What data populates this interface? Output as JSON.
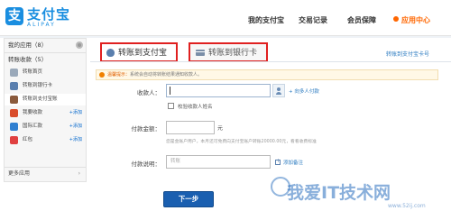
{
  "header": {
    "logo_cn": "支付宝",
    "logo_en": "ALIPAY",
    "nav": [
      "我的支付宝",
      "交易记录",
      "会员保障",
      "应用中心"
    ],
    "accent_nav_color": "#ff6600"
  },
  "sidebar": {
    "apps_title": "我的应用（8）",
    "collect_title": "转账收款（5）",
    "items": [
      {
        "label": "转账首页",
        "icon": "home-icon",
        "add": ""
      },
      {
        "label": "转账到银行卡",
        "icon": "bank-card-icon",
        "add": ""
      },
      {
        "label": "转账到支付宝账",
        "icon": "alipay-transfer-icon",
        "add": ""
      },
      {
        "label": "我要收款",
        "icon": "receive-money-icon",
        "add": "+添加"
      },
      {
        "label": "国际汇款",
        "icon": "globe-icon",
        "add": "+添加"
      },
      {
        "label": "红包",
        "icon": "red-envelope-icon",
        "add": "+添加"
      }
    ],
    "more": "更多应用"
  },
  "tabs": {
    "alipay": "转账到支付宝",
    "bank": "转账到银行卡"
  },
  "links": {
    "card_transfer": "转账到支付宝卡号"
  },
  "notice": {
    "label": "温馨提示：",
    "text": "系统会自动将转账结果通知收款人。"
  },
  "form": {
    "payee_label": "收款人：",
    "add_payee": "+ 向多人付款",
    "check_name": "校验收款人姓名",
    "amount_label": "付款金额：",
    "unit": "元",
    "hint": "您是金账户用户，本月还可免费向支付宝账户转账20000.00元，看看收费标准",
    "memo_label": "付款说明：",
    "memo_placeholder": "转账",
    "add_note": "添加备注",
    "next_button": "下一步"
  },
  "watermark": {
    "text": "我爱IT技术网",
    "sub": "www.52ij.com"
  }
}
